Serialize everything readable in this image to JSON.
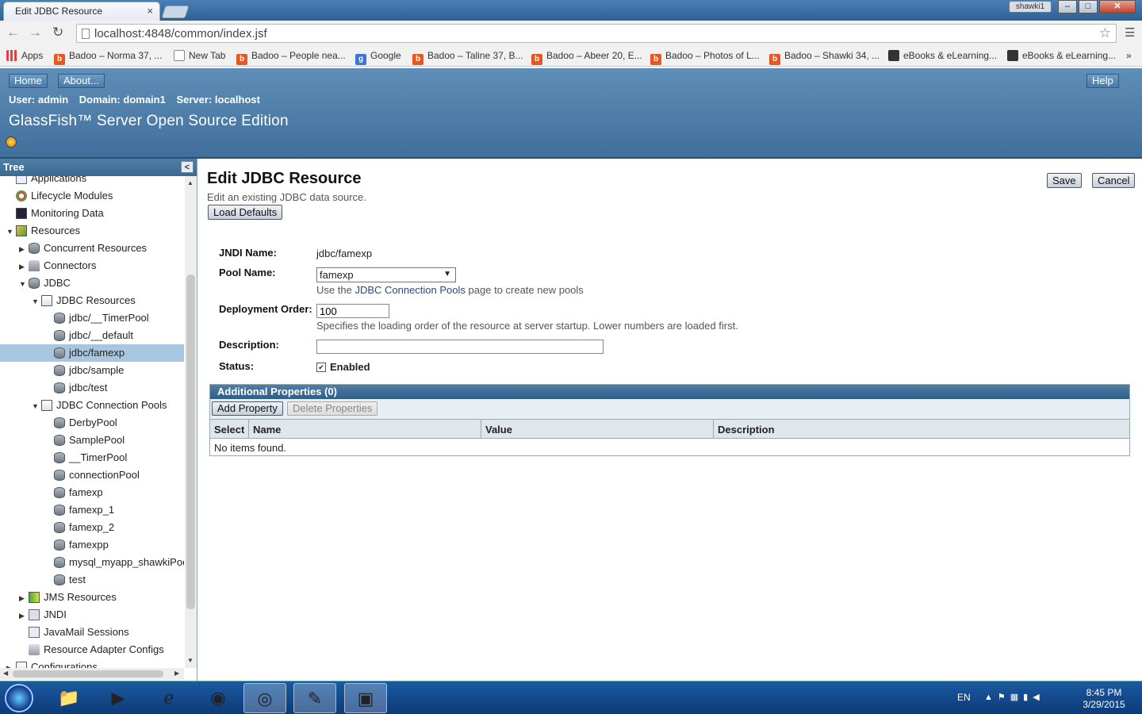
{
  "browser": {
    "tab_title": "Edit JDBC Resource",
    "tab_close": "×",
    "user_badge": "shawki1",
    "url": "localhost:4848/common/index.jsf",
    "bookmarks": [
      {
        "label": "Apps",
        "icon": "apps-icon"
      },
      {
        "label": "Badoo – Norma 37, ...",
        "icon": "badoo-icon"
      },
      {
        "label": "New Tab",
        "icon": "page-icon"
      },
      {
        "label": "Badoo – People nea...",
        "icon": "badoo-icon"
      },
      {
        "label": "Google",
        "icon": "google-icon"
      },
      {
        "label": "Badoo – Taline 37, B...",
        "icon": "badoo-icon"
      },
      {
        "label": "Badoo – Abeer 20, E...",
        "icon": "badoo-icon"
      },
      {
        "label": "Badoo – Photos of L...",
        "icon": "badoo-icon"
      },
      {
        "label": "Badoo – Shawki 34, ...",
        "icon": "badoo-icon"
      },
      {
        "label": "eBooks & eLearning...",
        "icon": "ebook-icon"
      },
      {
        "label": "eBooks & eLearning...",
        "icon": "ebook-icon"
      }
    ],
    "bookmarks_more": "»"
  },
  "header": {
    "home": "Home",
    "about": "About...",
    "help": "Help",
    "user": "User: admin",
    "domain": "Domain: domain1",
    "server": "Server: localhost",
    "title": "GlassFish™ Server Open Source Edition"
  },
  "tree": {
    "title": "Tree",
    "nodes": [
      {
        "label": "Applications",
        "icon": "app-icon",
        "level": 1,
        "arrow": ""
      },
      {
        "label": "Lifecycle Modules",
        "icon": "gear-icon",
        "level": 1,
        "arrow": ""
      },
      {
        "label": "Monitoring Data",
        "icon": "monitor-icon",
        "level": 1,
        "arrow": ""
      },
      {
        "label": "Resources",
        "icon": "resources-icon",
        "level": 1,
        "arrow": "▼"
      },
      {
        "label": "Concurrent Resources",
        "icon": "database-icon",
        "level": 2,
        "arrow": "▶"
      },
      {
        "label": "Connectors",
        "icon": "connector-icon",
        "level": 2,
        "arrow": "▶"
      },
      {
        "label": "JDBC",
        "icon": "database-icon",
        "level": 2,
        "arrow": "▼"
      },
      {
        "label": "JDBC Resources",
        "icon": "folder-icon",
        "level": 3,
        "arrow": "▼"
      },
      {
        "label": "jdbc/__TimerPool",
        "icon": "database-icon",
        "level": 4,
        "arrow": ""
      },
      {
        "label": "jdbc/__default",
        "icon": "database-icon",
        "level": 4,
        "arrow": ""
      },
      {
        "label": "jdbc/famexp",
        "icon": "database-icon",
        "level": 4,
        "arrow": "",
        "selected": true
      },
      {
        "label": "jdbc/sample",
        "icon": "database-icon",
        "level": 4,
        "arrow": ""
      },
      {
        "label": "jdbc/test",
        "icon": "database-icon",
        "level": 4,
        "arrow": ""
      },
      {
        "label": "JDBC Connection Pools",
        "icon": "folder-icon",
        "level": 3,
        "arrow": "▼"
      },
      {
        "label": "DerbyPool",
        "icon": "database-icon",
        "level": 4,
        "arrow": ""
      },
      {
        "label": "SamplePool",
        "icon": "database-icon",
        "level": 4,
        "arrow": ""
      },
      {
        "label": "__TimerPool",
        "icon": "database-icon",
        "level": 4,
        "arrow": ""
      },
      {
        "label": "connectionPool",
        "icon": "database-icon",
        "level": 4,
        "arrow": ""
      },
      {
        "label": "famexp",
        "icon": "database-icon",
        "level": 4,
        "arrow": ""
      },
      {
        "label": "famexp_1",
        "icon": "database-icon",
        "level": 4,
        "arrow": ""
      },
      {
        "label": "famexp_2",
        "icon": "database-icon",
        "level": 4,
        "arrow": ""
      },
      {
        "label": "famexpp",
        "icon": "database-icon",
        "level": 4,
        "arrow": ""
      },
      {
        "label": "mysql_myapp_shawkiPool",
        "icon": "database-icon",
        "level": 4,
        "arrow": ""
      },
      {
        "label": "test",
        "icon": "database-icon",
        "level": 4,
        "arrow": ""
      },
      {
        "label": "JMS Resources",
        "icon": "jms-icon",
        "level": 2,
        "arrow": "▶"
      },
      {
        "label": "JNDI",
        "icon": "jndi-icon",
        "level": 2,
        "arrow": "▶"
      },
      {
        "label": "JavaMail Sessions",
        "icon": "mail-icon",
        "level": 2,
        "arrow": ""
      },
      {
        "label": "Resource Adapter Configs",
        "icon": "adapter-icon",
        "level": 2,
        "arrow": ""
      },
      {
        "label": "Configurations",
        "icon": "folder-icon",
        "level": 1,
        "arrow": "▶"
      }
    ]
  },
  "main": {
    "title": "Edit JDBC Resource",
    "description": "Edit an existing JDBC data source.",
    "load_defaults": "Load Defaults",
    "save": "Save",
    "cancel": "Cancel",
    "jndi_label": "JNDI Name:",
    "jndi_value": "jdbc/famexp",
    "pool_label": "Pool Name:",
    "pool_value": "famexp",
    "pool_help_prefix": "Use the",
    "pool_help_link": "JDBC Connection Pools",
    "pool_help_suffix": "page to create new pools",
    "order_label": "Deployment Order:",
    "order_value": "100",
    "order_help": "Specifies the loading order of the resource at server startup. Lower numbers are loaded first.",
    "desc_label": "Description:",
    "desc_value": "",
    "status_label": "Status:",
    "status_value": "Enabled",
    "props_title": "Additional Properties (0)",
    "add_property": "Add Property",
    "delete_properties": "Delete Properties",
    "columns": [
      "Select",
      "Name",
      "Value",
      "Description"
    ],
    "empty": "No items found."
  },
  "taskbar": {
    "lang": "EN",
    "time": "8:45 PM",
    "date": "3/29/2015"
  }
}
